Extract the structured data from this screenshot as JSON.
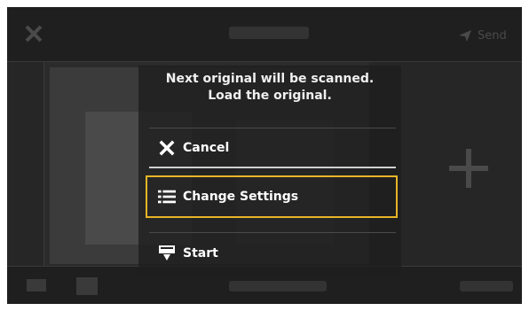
{
  "background": {
    "send_label": "Send"
  },
  "dialog": {
    "message_line1": "Next original will be scanned.",
    "message_line2": "Load the original.",
    "options": [
      {
        "label": "Cancel",
        "icon": "close-icon"
      },
      {
        "label": "Change Settings",
        "icon": "settings-list-icon"
      },
      {
        "label": "Start",
        "icon": "scan-start-icon"
      }
    ]
  },
  "colors": {
    "focus_outline": "#e8b526",
    "dialog_bg": "#1e1e1e",
    "text": "#ffffff"
  }
}
